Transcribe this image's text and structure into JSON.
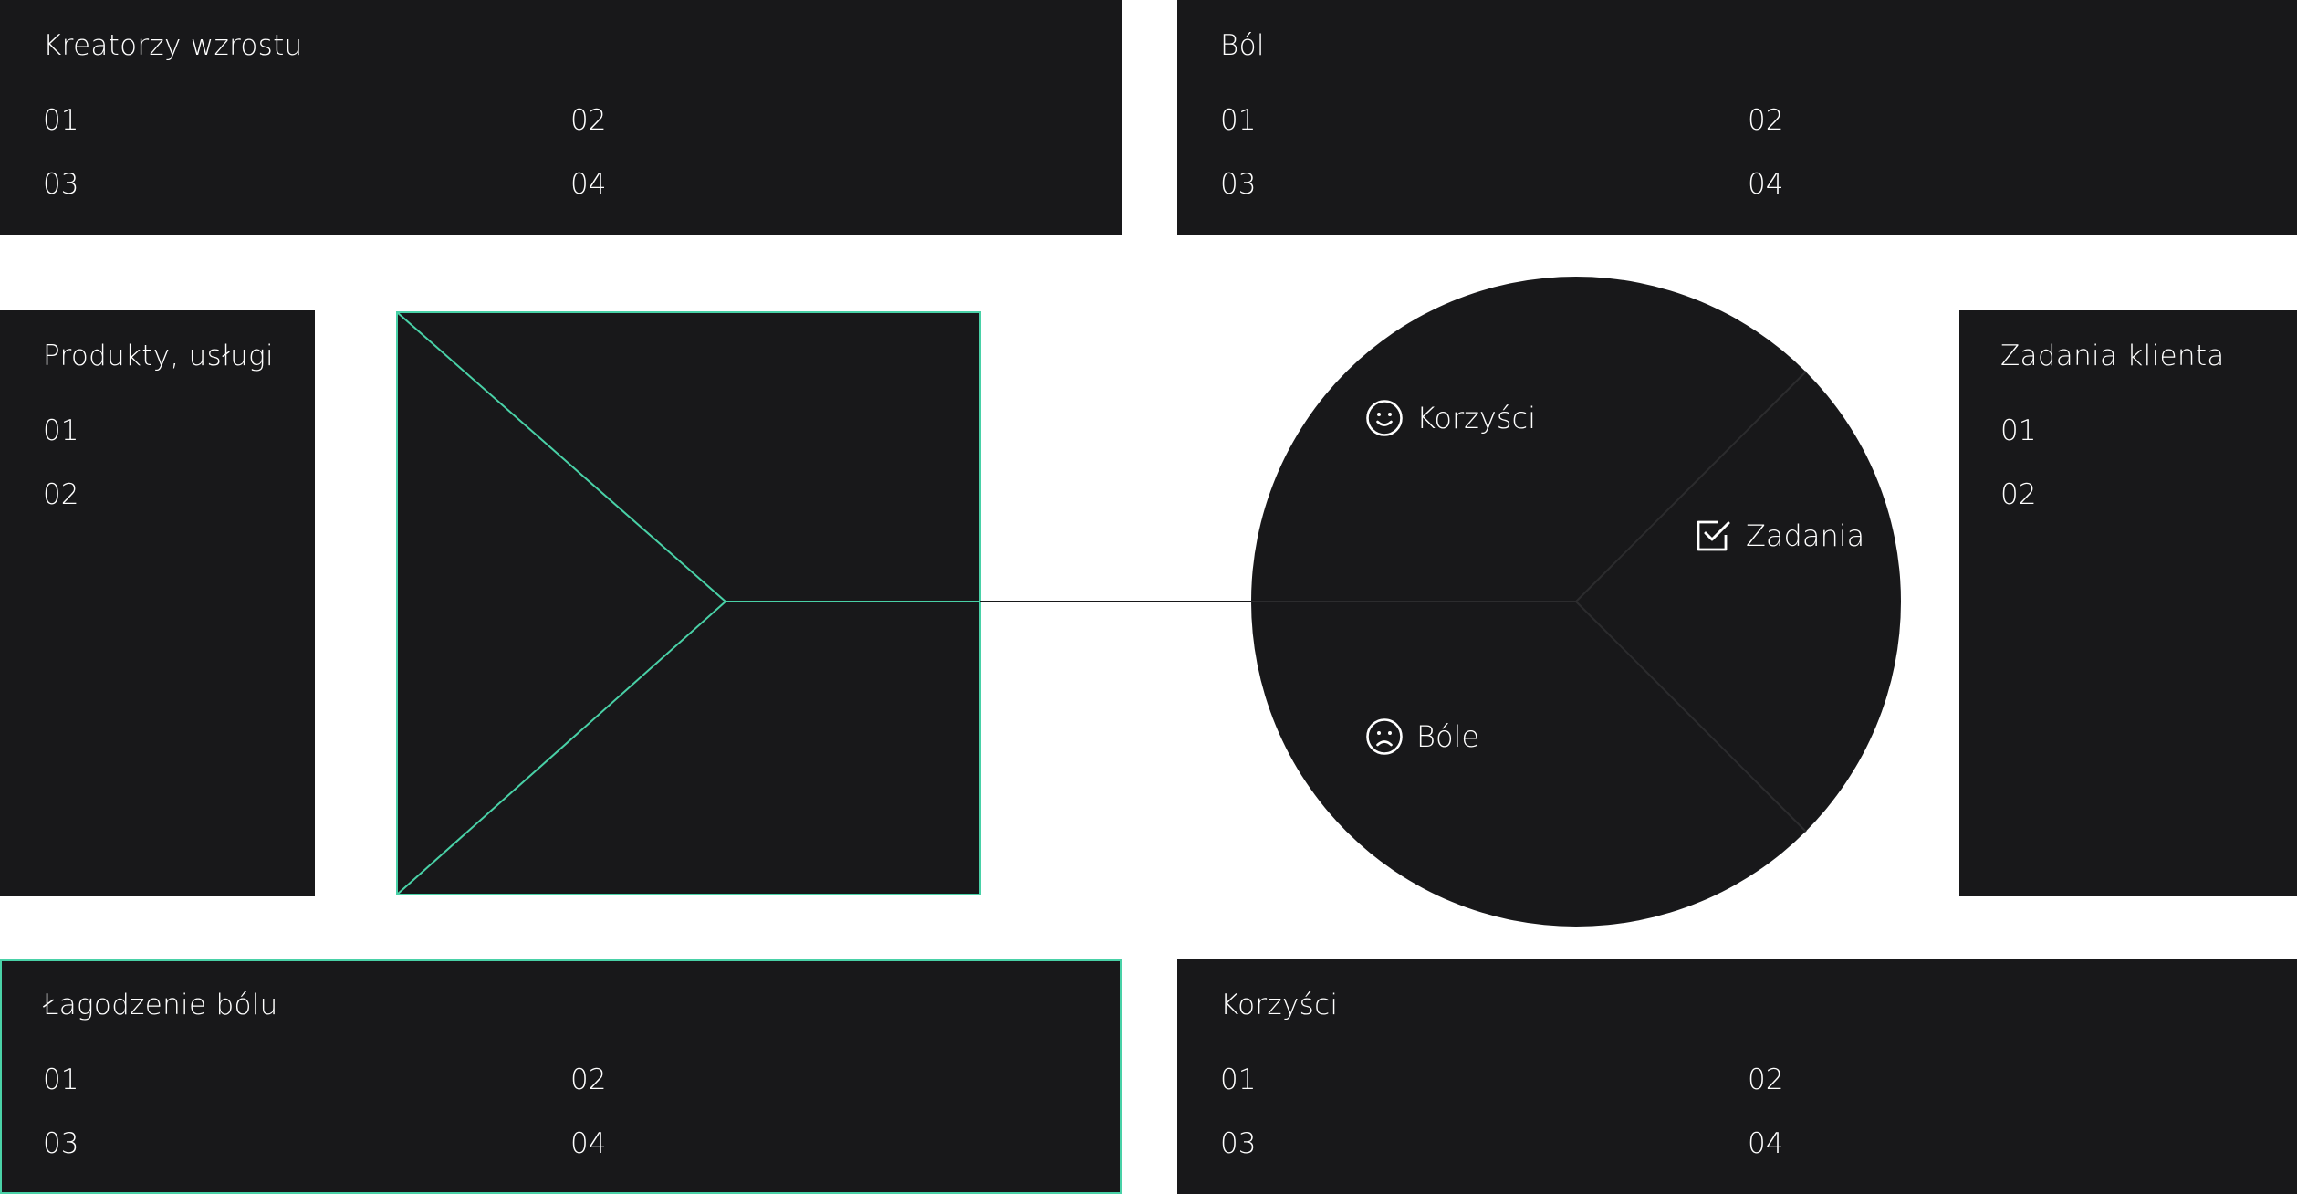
{
  "panels": {
    "growth_creators": {
      "title": "Kreatorzy wzrostu",
      "items": [
        "01",
        "02",
        "03",
        "04"
      ]
    },
    "pain": {
      "title": "Ból",
      "items": [
        "01",
        "02",
        "03",
        "04"
      ]
    },
    "products_services": {
      "title": "Produkty, usługi",
      "items": [
        "01",
        "02"
      ]
    },
    "customer_jobs": {
      "title": "Zadania klienta",
      "items": [
        "01",
        "02"
      ]
    },
    "pain_relievers": {
      "title": "Łagodzenie bólu",
      "items": [
        "01",
        "02",
        "03",
        "04"
      ]
    },
    "gains": {
      "title": "Korzyści",
      "items": [
        "01",
        "02",
        "03",
        "04"
      ]
    }
  },
  "customer_circle": {
    "gains_label": "Korzyści",
    "jobs_label": "Zadania",
    "pains_label": "Bóle",
    "gains_icon": "smile-icon",
    "jobs_icon": "checkbox-icon",
    "pains_icon": "frown-icon"
  },
  "colors": {
    "panel_bg": "#18181a",
    "accent": "#49d1a7",
    "text": "#ffffff",
    "background": "#ffffff"
  }
}
